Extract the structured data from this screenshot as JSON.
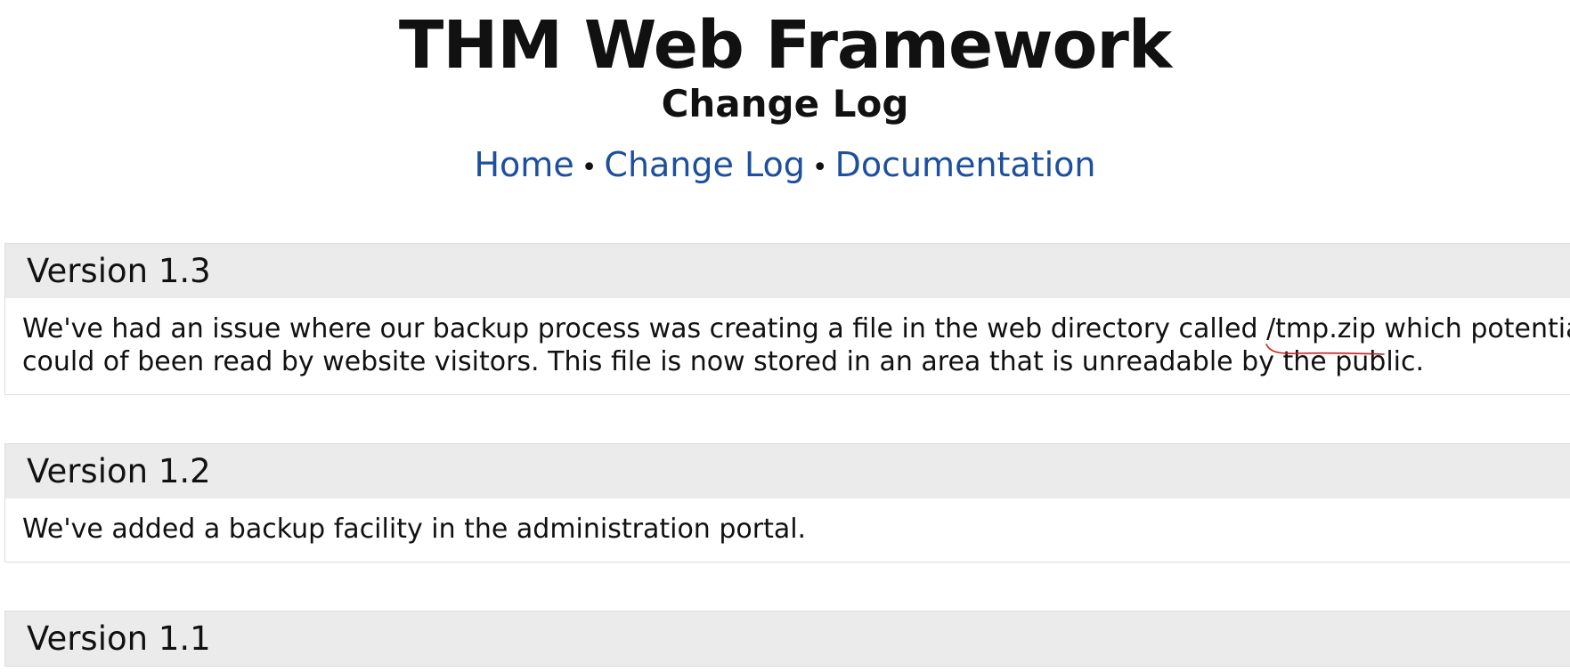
{
  "header": {
    "title": "THM Web Framework",
    "subtitle": "Change Log"
  },
  "nav": {
    "items": [
      {
        "label": "Home"
      },
      {
        "label": "Change Log"
      },
      {
        "label": "Documentation"
      }
    ],
    "separator": "•"
  },
  "changelog": {
    "entries": [
      {
        "version": "Version 1.3",
        "text_before": "We've had an issue where our backup process was creating a file in the web directory called ",
        "highlight": "/tmp.zip",
        "text_after": " which potentially",
        "line2": "could of been read by website visitors. This file is now stored in an area that is unreadable by the public."
      },
      {
        "version": "Version 1.2",
        "text": "We've added a backup facility in the administration portal."
      },
      {
        "version": "Version 1.1"
      }
    ]
  },
  "colors": {
    "link": "#1d4f9e",
    "entry_header_bg": "#ebebeb",
    "annotation": "#cc2222"
  }
}
